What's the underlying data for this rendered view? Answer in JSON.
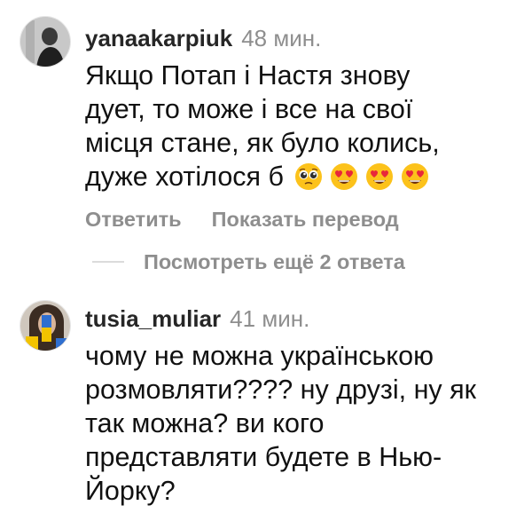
{
  "comments": [
    {
      "username": "yanaakarpiuk",
      "time": "48 мин.",
      "text_lines": [
        "Якщо Потап  і Настя знову",
        "дует, то може і все на свої",
        "місця стане, як було колись,",
        "дуже хотілося б"
      ],
      "emojis": [
        "pleading-face-icon",
        "heart-eyes-icon",
        "heart-eyes-icon",
        "heart-eyes-icon"
      ],
      "reply_label": "Ответить",
      "translate_label": "Показать перевод",
      "view_replies_label": "Посмотреть ещё 2 ответа"
    },
    {
      "username": "tusia_muliar",
      "time": "41 мин.",
      "text_lines": [
        "чому не можна українською",
        "розмовляти???? ну друзі, ну як",
        "так можна? ви кого",
        "представляти будете в Нью-",
        "Йорку?"
      ]
    }
  ],
  "colors": {
    "username": "#262626",
    "muted": "#8e8e8e",
    "divider": "#dbdbdb",
    "heart": "#e8273b",
    "emoji_face": "#fcc21b"
  }
}
